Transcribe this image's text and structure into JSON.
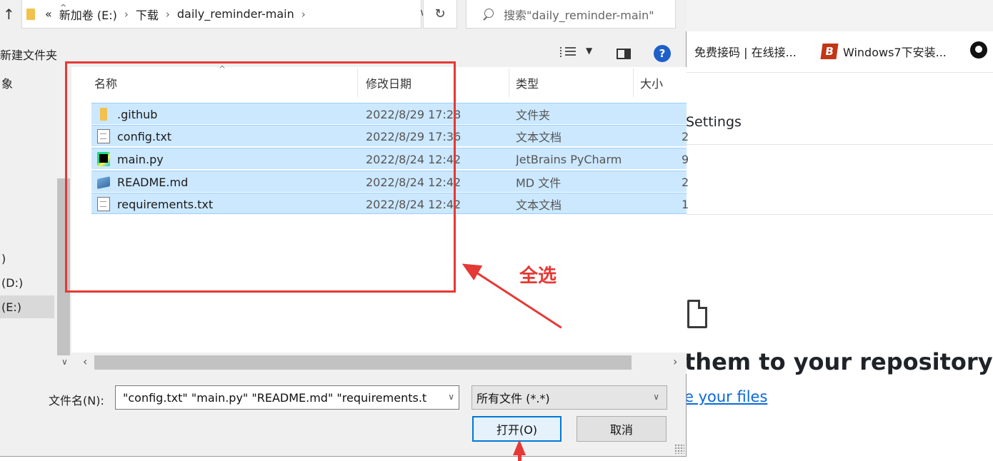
{
  "browser": {
    "bookmarks": [
      {
        "label": "免费接码 | 在线接..."
      },
      {
        "label": "Windows7下安装..."
      }
    ],
    "settings_label": "Settings",
    "headline": "them to your repository",
    "link": "e your files"
  },
  "dialog": {
    "address": {
      "breadcrumbs": [
        "«",
        "新加卷 (E:)",
        "下载",
        "daily_reminder-main"
      ]
    },
    "search": {
      "placeholder": "搜索\"daily_reminder-main\""
    },
    "toolbar": {
      "new_folder": "新建文件夹"
    },
    "nav": {
      "items": [
        {
          "label": "象"
        },
        {
          "label": ")"
        },
        {
          "label": "(D:)"
        },
        {
          "label": "(E:)"
        }
      ]
    },
    "columns": [
      "名称",
      "修改日期",
      "类型",
      "大小"
    ],
    "files": [
      {
        "name": ".github",
        "date": "2022/8/29 17:28",
        "type": "文件夹",
        "size": "",
        "icon": "folder-icon"
      },
      {
        "name": "config.txt",
        "date": "2022/8/29 17:36",
        "type": "文本文档",
        "size": "2",
        "icon": "text-file-icon"
      },
      {
        "name": "main.py",
        "date": "2022/8/24 12:42",
        "type": "JetBrains PyCharm",
        "size": "9",
        "icon": "pycharm-file-icon"
      },
      {
        "name": "README.md",
        "date": "2022/8/24 12:42",
        "type": "MD 文件",
        "size": "2",
        "icon": "markdown-file-icon"
      },
      {
        "name": "requirements.txt",
        "date": "2022/8/24 12:42",
        "type": "文本文档",
        "size": "1",
        "icon": "text-file-icon"
      }
    ],
    "filename": {
      "label": "文件名(N):",
      "value": "\"config.txt\" \"main.py\" \"README.md\" \"requirements.t"
    },
    "filetype": {
      "selected": "所有文件 (*.*)"
    },
    "buttons": {
      "open": "打开(O)",
      "cancel": "取消"
    }
  },
  "annotation": {
    "label": "全选",
    "color": "#e53935"
  },
  "colors": {
    "selection": "#cce8ff",
    "accent": "#0078d7",
    "link": "#0969da"
  }
}
